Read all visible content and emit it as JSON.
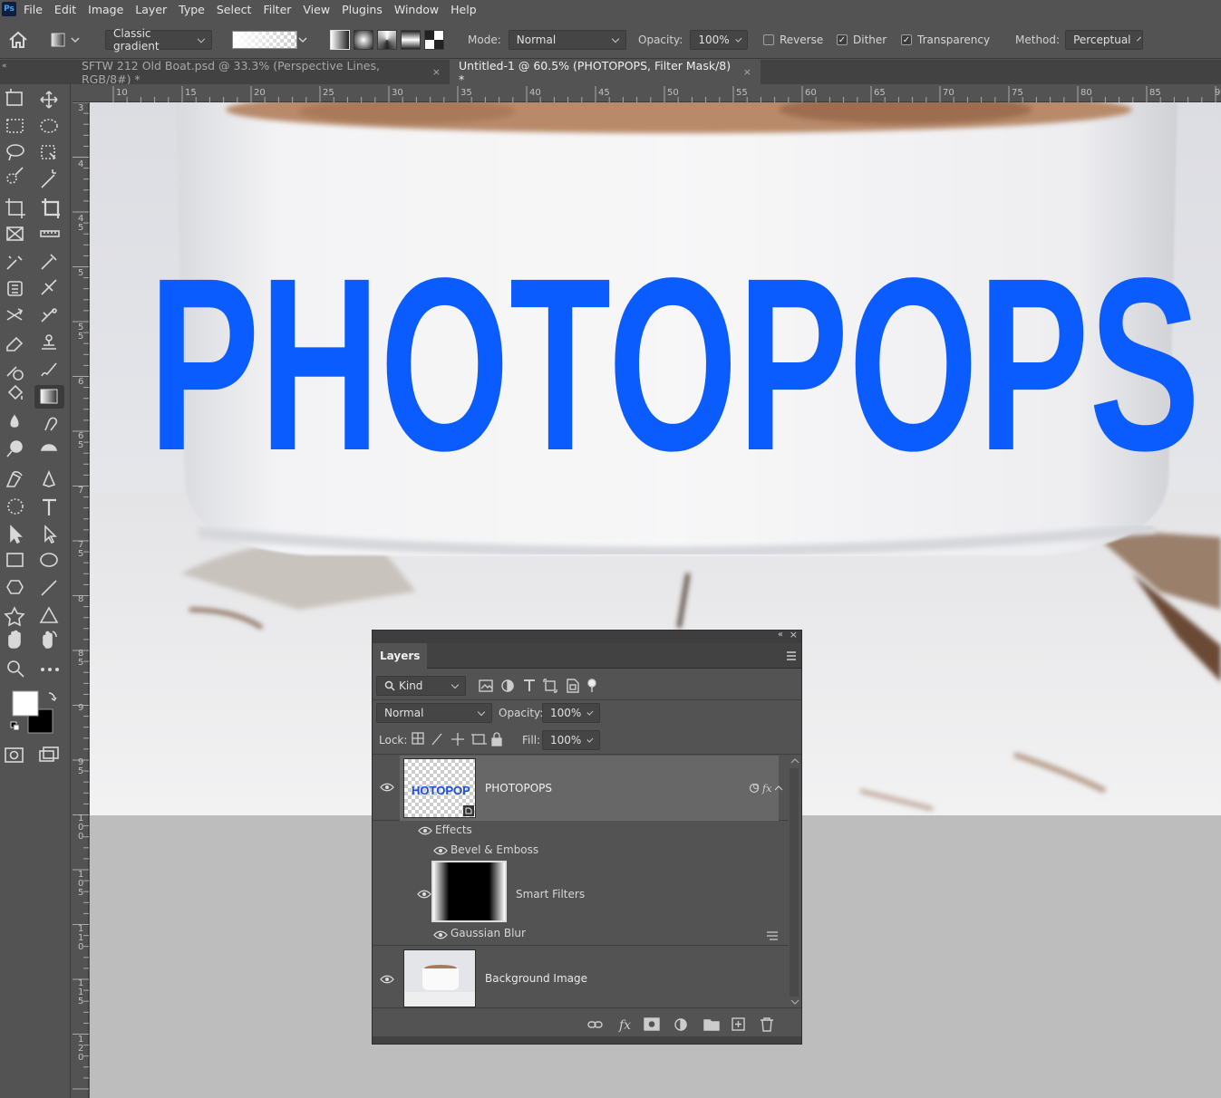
{
  "app": {
    "logo": "Ps"
  },
  "menu": [
    "File",
    "Edit",
    "Image",
    "Layer",
    "Type",
    "Select",
    "Filter",
    "View",
    "Plugins",
    "Window",
    "Help"
  ],
  "options": {
    "gradient_preset": "Classic gradient",
    "mode_label": "Mode:",
    "mode_value": "Normal",
    "opacity_label": "Opacity:",
    "opacity_value": "100%",
    "reverse_label": "Reverse",
    "reverse_checked": false,
    "dither_label": "Dither",
    "dither_checked": true,
    "transparency_label": "Transparency",
    "transparency_checked": true,
    "method_label": "Method:",
    "method_value": "Perceptual"
  },
  "tabs": [
    {
      "label": "SFTW 212 Old Boat.psd @ 33.3% (Perspective Lines, RGB/8#) *",
      "active": false
    },
    {
      "label": "Untitled-1 @ 60.5% (PHOTOPOPS, Filter Mask/8) *",
      "active": true
    }
  ],
  "ruler_h": [
    "10",
    "15",
    "20",
    "25",
    "30",
    "35",
    "40",
    "45",
    "50",
    "55",
    "60",
    "65",
    "70",
    "75",
    "80",
    "85",
    "9"
  ],
  "ruler_v": [
    "3",
    "4",
    "4 5",
    "5",
    "5 5",
    "6",
    "6 5",
    "7",
    "7 5",
    "8",
    "8 5",
    "9",
    "9 5",
    "1 0 0",
    "1 0 5",
    "1 1 0",
    "1 1 5",
    "1 2 0"
  ],
  "canvas": {
    "text": "PHOTOPOPS",
    "text_color": "#0a5cff"
  },
  "layers": {
    "title": "Layers",
    "filter_kind": "Kind",
    "blend_mode": "Normal",
    "opacity_label": "Opacity:",
    "opacity_value": "100%",
    "lock_label": "Lock:",
    "fill_label": "Fill:",
    "fill_value": "100%",
    "items": {
      "photopops": {
        "name": "PHOTOPOPS",
        "thumb_text": "HOTOPOP"
      },
      "effects": "Effects",
      "bevel": "Bevel & Emboss",
      "smart_filters": "Smart Filters",
      "gaussian": "Gaussian Blur",
      "background": "Background Image"
    }
  },
  "colors": {
    "accent": "#0a5cff",
    "panel": "#535353",
    "selected_row": "#636363"
  }
}
